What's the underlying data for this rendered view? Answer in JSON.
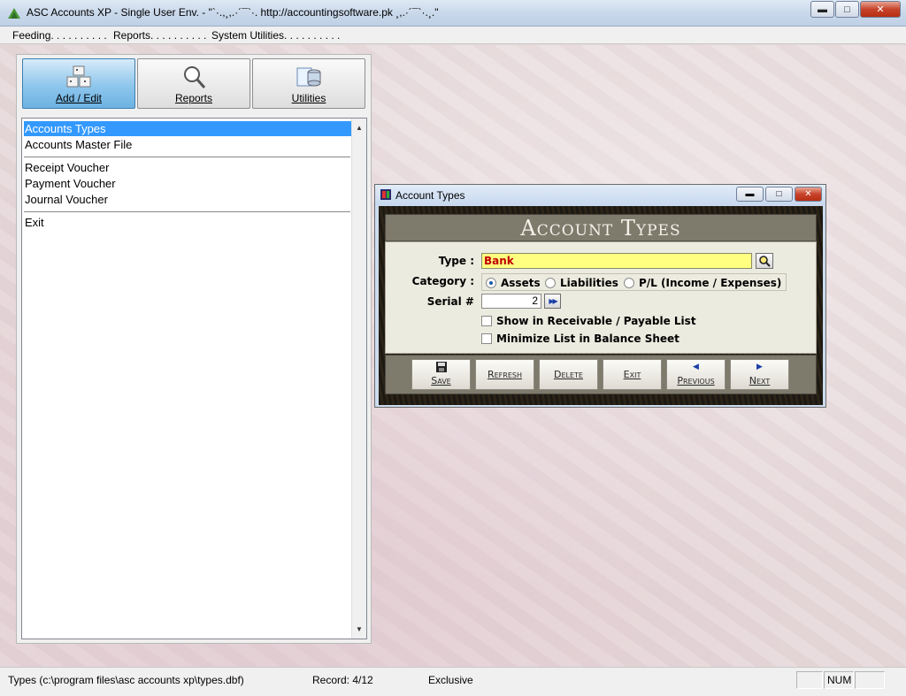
{
  "window": {
    "title": "ASC Accounts XP - Single User Env.  -  \"`·.,¸,.·´¯`·. http://accountingsoftware.pk ¸,.·´¯`·.¸.\"",
    "min_glyph": "▬",
    "max_glyph": "□",
    "close_glyph": "✕"
  },
  "menu": {
    "items": [
      "Feeding. . . . . . . . . .",
      "Reports. . . . . . . . . .",
      "System Utilities. . . . . . . . . ."
    ]
  },
  "nav": {
    "add_edit": "Add / Edit",
    "reports": "Reports",
    "utilities": "Utilities",
    "active": "add_edit"
  },
  "list": {
    "items": [
      "Accounts Types",
      "Accounts Master File",
      "Receipt Voucher",
      "Payment Voucher",
      "Journal Voucher",
      "Exit"
    ],
    "selected": "Accounts Types"
  },
  "dialog": {
    "title": "Account Types",
    "header": "Account Types",
    "type_label": "Type :",
    "type_value": "Bank",
    "category_label": "Category :",
    "categories": [
      "Assets",
      "Liabilities",
      "P/L (Income / Expenses)"
    ],
    "category_selected": "Assets",
    "serial_label": "Serial #",
    "serial_value": "2",
    "checkbox_receivable": "Show in Receivable / Payable List",
    "checkbox_minimize": "Minimize List in Balance Sheet",
    "buttons": {
      "save": "Save",
      "refresh": "Refresh",
      "delete": "Delete",
      "exit": "Exit",
      "previous": "Previous",
      "next": "Next"
    }
  },
  "status": {
    "path": "Types (c:\\program files\\asc accounts xp\\types.dbf)",
    "record": "Record: 4/12",
    "mode": "Exclusive",
    "num": "NUM"
  },
  "colors": {
    "selection": "#3399ff",
    "type_field_bg": "#ffff80",
    "type_field_text": "#c00000",
    "dialog_header": "#7e7a6c"
  }
}
